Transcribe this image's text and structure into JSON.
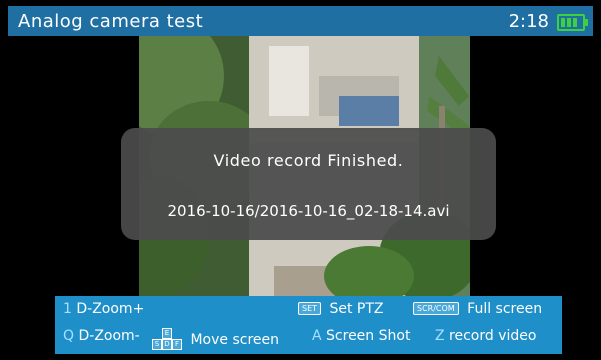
{
  "header": {
    "title": "Analog camera test",
    "time": "2:18",
    "battery_icon": "battery-icon",
    "battery_color": "#3ed13e"
  },
  "dialog": {
    "line1": "Video record Finished.",
    "line2": "2016-10-16/2016-10-16_02-18-14.avi"
  },
  "help": {
    "row1": [
      {
        "key": "1",
        "label": "D-Zoom+"
      },
      {
        "key": "SET",
        "label": "Set PTZ"
      },
      {
        "key": "SCR/COM",
        "label": "Full screen"
      }
    ],
    "row2": [
      {
        "key": "Q",
        "label": "D-Zoom-"
      },
      {
        "key_e": "E",
        "key_s": "S",
        "key_d": "D",
        "key_f": "F",
        "label": "Move screen"
      },
      {
        "key": "A",
        "label": "Screen Shot"
      },
      {
        "key": "Z",
        "label": "record video"
      }
    ]
  },
  "colors": {
    "title_bar": "#1f6fa3",
    "help_bar": "#1e8fc9",
    "dialog_bg": "#4b4b4b"
  }
}
